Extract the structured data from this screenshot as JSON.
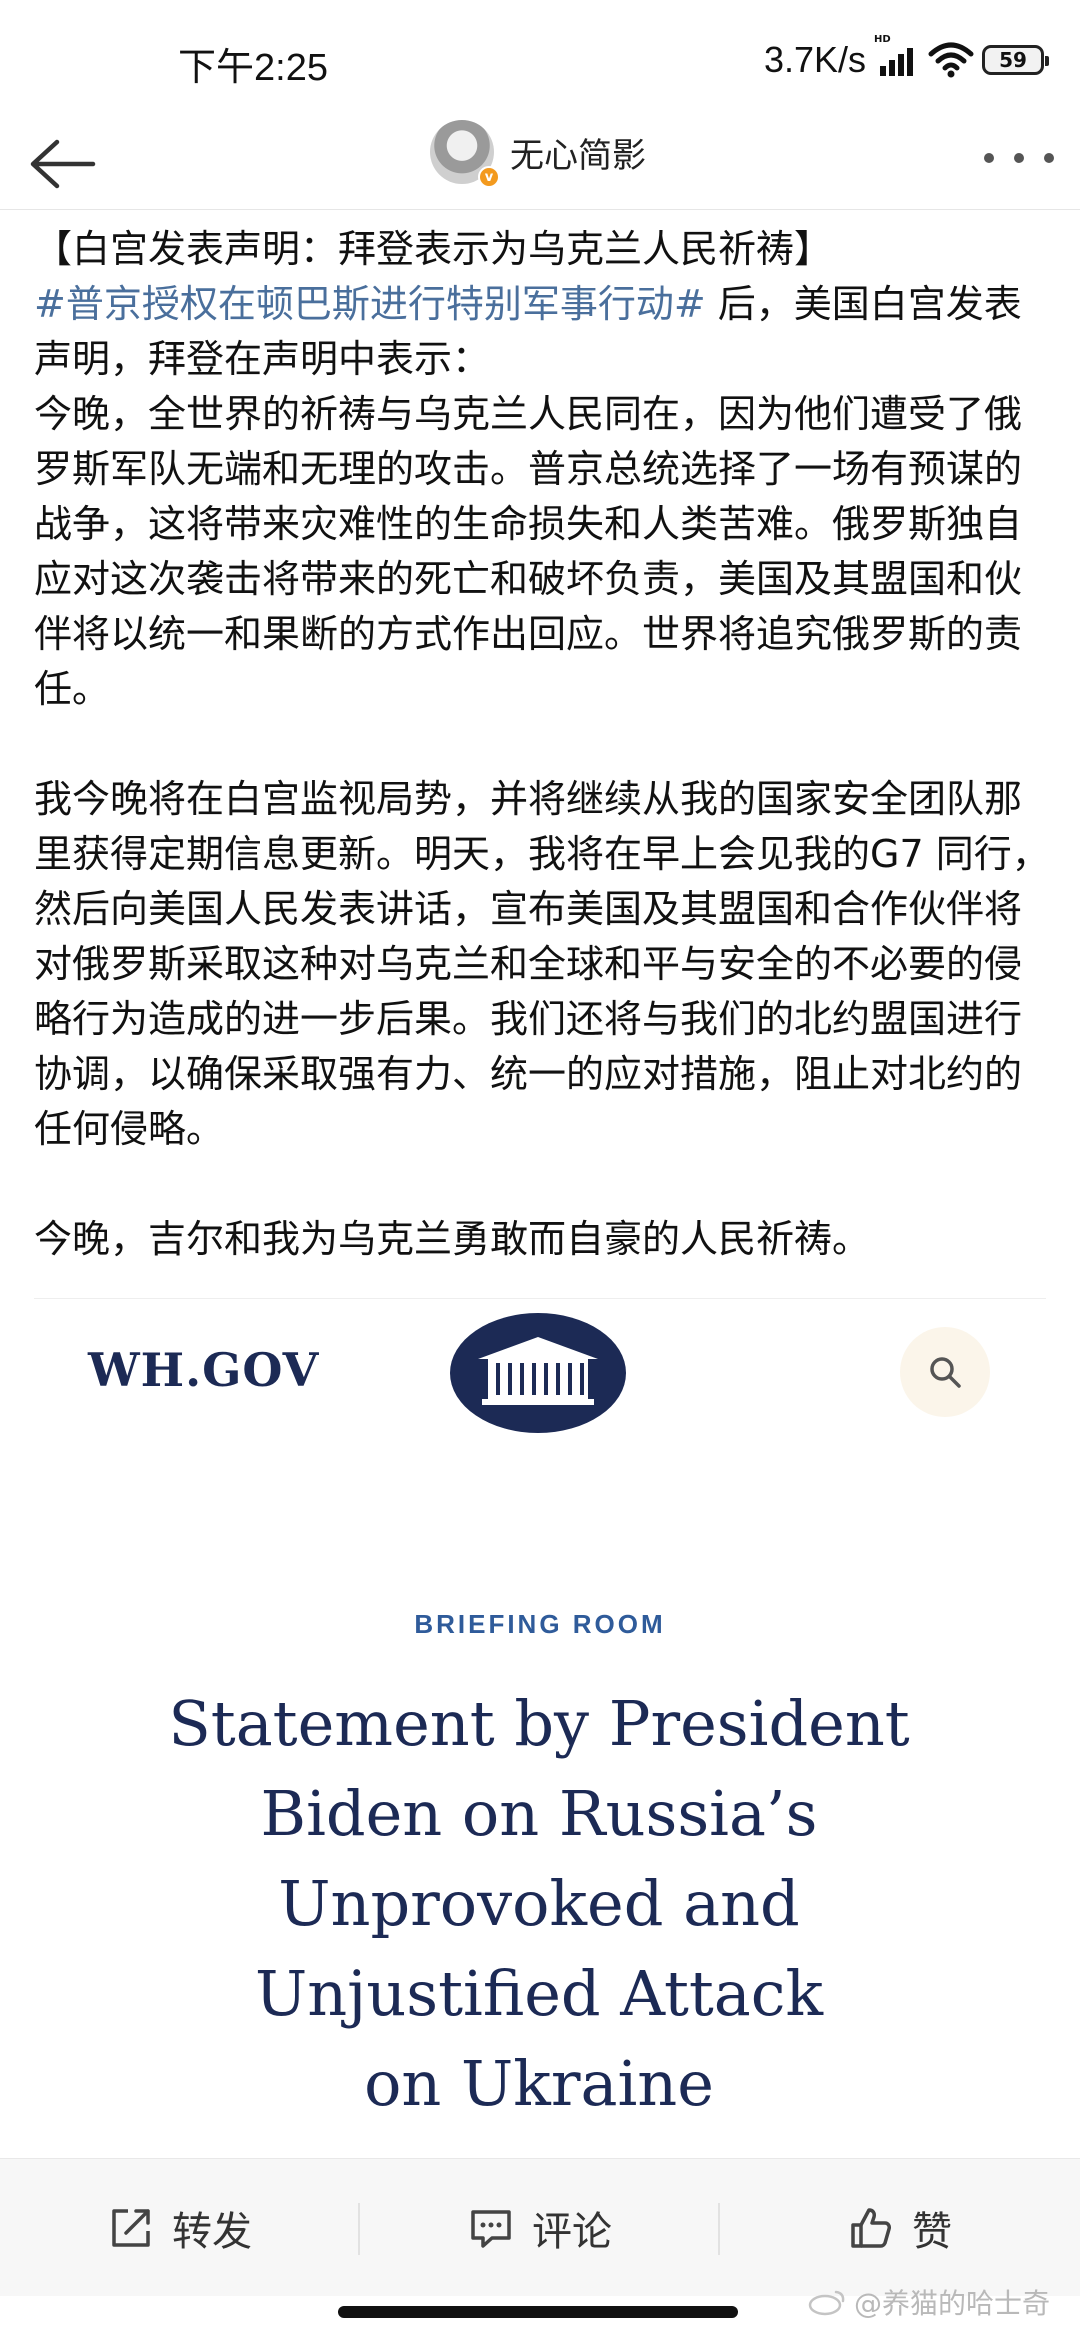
{
  "status_bar": {
    "time": "下午2:25",
    "net_speed": "3.7K/s",
    "signal_label": "HD",
    "battery": "59"
  },
  "nav": {
    "username": "无心简影",
    "back_icon": "arrow-left-icon",
    "more_icon": "more-dots-icon"
  },
  "post": {
    "title": "【白宫发表声明：拜登表示为乌克兰人民祈祷】",
    "hashtag": "#普京授权在顿巴斯进行特别军事行动#",
    "intro": " 后，美国白宫发表声明，拜登在声明中表示：",
    "para1": "今晚，全世界的祈祷与乌克兰人民同在，因为他们遭受了俄罗斯军队无端和无理的攻击。普京总统选择了一场有预谋的战争，这将带来灾难性的生命损失和人类苦难。俄罗斯独自应对这次袭击将带来的死亡和破坏负责，美国及其盟国和伙伴将以统一和果断的方式作出回应。世界将追究俄罗斯的责任。",
    "para2": "我今晚将在白宫监视局势，并将继续从我的国家安全团队那里获得定期信息更新。明天，我将在早上会见我的G7 同行，然后向美国人民发表讲话，宣布美国及其盟国和合作伙伴将对俄罗斯采取这种对乌克兰和全球和平与安全的不必要的侵略行为造成的进一步后果。我们还将与我们的北约盟国进行协调，以确保采取强有力、统一的应对措施，阻止对北约的任何侵略。",
    "para3": "今晚，吉尔和我为乌克兰勇敢而自豪的人民祈祷。"
  },
  "embed": {
    "logo": "WH.GOV",
    "section": "BRIEFING ROOM",
    "title_lines": [
      "Statement by President",
      "Biden on Russia’s",
      "Unprovoked and",
      "Unjustified Attack",
      "on Ukraine"
    ]
  },
  "actions": {
    "repost": "转发",
    "comment": "评论",
    "like": "赞"
  },
  "watermark": "@养猫的哈士奇"
}
